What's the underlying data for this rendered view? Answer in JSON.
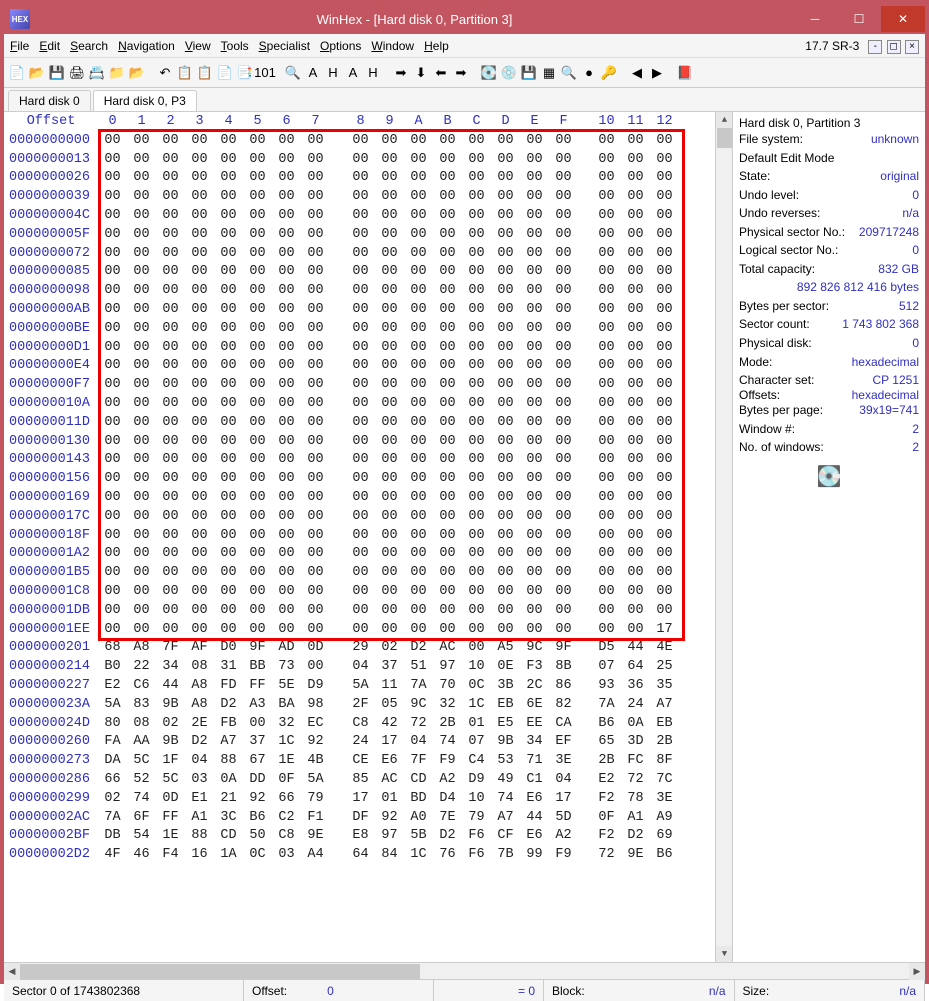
{
  "title": "WinHex - [Hard disk 0, Partition 3]",
  "version": "17.7 SR-3",
  "menus": [
    "File",
    "Edit",
    "Search",
    "Navigation",
    "View",
    "Tools",
    "Specialist",
    "Options",
    "Window",
    "Help"
  ],
  "tabs": [
    {
      "label": "Hard disk 0",
      "active": false
    },
    {
      "label": "Hard disk 0, P3",
      "active": true
    }
  ],
  "header_offset_label": "Offset",
  "cols": [
    "0",
    "1",
    "2",
    "3",
    "4",
    "5",
    "6",
    "7",
    "8",
    "9",
    "A",
    "B",
    "C",
    "D",
    "E",
    "F",
    "10",
    "11",
    "12"
  ],
  "zero_offsets": [
    "0000000000",
    "0000000013",
    "0000000026",
    "0000000039",
    "000000004C",
    "000000005F",
    "0000000072",
    "0000000085",
    "0000000098",
    "00000000AB",
    "00000000BE",
    "00000000D1",
    "00000000E4",
    "00000000F7",
    "000000010A",
    "000000011D",
    "0000000130",
    "0000000143",
    "0000000156",
    "0000000169",
    "000000017C",
    "000000018F",
    "00000001A2",
    "00000001B5",
    "00000001C8",
    "00000001DB",
    "00000001EE"
  ],
  "last_zero_tail": "17",
  "data_rows": [
    {
      "off": "0000000201",
      "b": [
        "68",
        "A8",
        "7F",
        "AF",
        "D0",
        "9F",
        "AD",
        "0D",
        "29",
        "02",
        "D2",
        "AC",
        "00",
        "A5",
        "9C",
        "9F",
        "D5",
        "44",
        "4E"
      ]
    },
    {
      "off": "0000000214",
      "b": [
        "B0",
        "22",
        "34",
        "08",
        "31",
        "BB",
        "73",
        "04",
        "37",
        "51",
        "97",
        "10",
        "0E",
        "F3",
        "8B",
        "07",
        "64",
        "25"
      ]
    },
    {
      "off": "0000000227",
      "b": [
        "E2",
        "C6",
        "44",
        "A8",
        "FD",
        "FF",
        "5E",
        "D9",
        "5A",
        "11",
        "7A",
        "70",
        "0C",
        "3B",
        "2C",
        "86",
        "93",
        "36",
        "35"
      ]
    },
    {
      "off": "000000023A",
      "b": [
        "5A",
        "83",
        "9B",
        "A8",
        "D2",
        "A3",
        "BA",
        "98",
        "2F",
        "05",
        "9C",
        "32",
        "1C",
        "EB",
        "6E",
        "82",
        "7A",
        "24",
        "A7"
      ]
    },
    {
      "off": "000000024D",
      "b": [
        "80",
        "08",
        "02",
        "2E",
        "FB",
        "00",
        "32",
        "EC",
        "C8",
        "42",
        "72",
        "2B",
        "01",
        "E5",
        "EE",
        "CA",
        "B6",
        "0A",
        "EB"
      ]
    },
    {
      "off": "0000000260",
      "b": [
        "FA",
        "AA",
        "9B",
        "D2",
        "A7",
        "37",
        "1C",
        "92",
        "24",
        "17",
        "04",
        "74",
        "07",
        "9B",
        "34",
        "EF",
        "65",
        "3D",
        "2B"
      ]
    },
    {
      "off": "0000000273",
      "b": [
        "DA",
        "5C",
        "1F",
        "04",
        "88",
        "67",
        "1E",
        "4B",
        "CE",
        "E6",
        "7F",
        "F9",
        "C4",
        "53",
        "71",
        "3E",
        "2B",
        "FC",
        "8F"
      ]
    },
    {
      "off": "0000000286",
      "b": [
        "66",
        "52",
        "5C",
        "03",
        "0A",
        "DD",
        "0F",
        "5A",
        "85",
        "AC",
        "CD",
        "A2",
        "D9",
        "49",
        "C1",
        "04",
        "E2",
        "72",
        "7C"
      ]
    },
    {
      "off": "0000000299",
      "b": [
        "02",
        "74",
        "0D",
        "E1",
        "21",
        "92",
        "66",
        "79",
        "17",
        "01",
        "BD",
        "D4",
        "10",
        "74",
        "E6",
        "17",
        "F2",
        "78",
        "3E"
      ]
    },
    {
      "off": "00000002AC",
      "b": [
        "7A",
        "6F",
        "FF",
        "A1",
        "3C",
        "B6",
        "C2",
        "F1",
        "DF",
        "92",
        "A0",
        "7E",
        "79",
        "A7",
        "44",
        "5D",
        "0F",
        "A1",
        "A9"
      ]
    },
    {
      "off": "00000002BF",
      "b": [
        "DB",
        "54",
        "1E",
        "88",
        "CD",
        "50",
        "C8",
        "9E",
        "E8",
        "97",
        "5B",
        "D2",
        "F6",
        "CF",
        "E6",
        "A2",
        "F2",
        "D2",
        "69"
      ]
    },
    {
      "off": "00000002D2",
      "b": [
        "4F",
        "46",
        "F4",
        "16",
        "1A",
        "0C",
        "03",
        "A4",
        "64",
        "84",
        "1C",
        "76",
        "F6",
        "7B",
        "99",
        "F9",
        "72",
        "9E",
        "B6"
      ]
    }
  ],
  "info": {
    "title": "Hard disk 0, Partition 3",
    "fs_label": "File system:",
    "fs_value": "unknown",
    "mode_title": "Default Edit Mode",
    "state_label": "State:",
    "state_value": "original",
    "undo_label": "Undo level:",
    "undo_value": "0",
    "undorev_label": "Undo reverses:",
    "undorev_value": "n/a",
    "phys_label": "Physical sector No.:",
    "phys_value": "209717248",
    "log_label": "Logical sector No.:",
    "log_value": "0",
    "cap_label": "Total capacity:",
    "cap_value": "832 GB",
    "cap_bytes": "892 826 812 416 bytes",
    "bps_label": "Bytes per sector:",
    "bps_value": "512",
    "sc_label": "Sector count:",
    "sc_value": "1 743 802 368",
    "pd_label": "Physical disk:",
    "pd_value": "0",
    "mode_label": "Mode:",
    "mode_value": "hexadecimal",
    "cs_label": "Character set:",
    "cs_value": "CP 1251",
    "off_label": "Offsets:",
    "off_value": "hexadecimal",
    "bpp_label": "Bytes per page:",
    "bpp_value": "39x19=741",
    "win_label": "Window #:",
    "win_value": "2",
    "nwin_label": "No. of windows:",
    "nwin_value": "2"
  },
  "status": {
    "sector": "Sector 0 of 1743802368",
    "offset_label": "Offset:",
    "offset_value": "0",
    "eq": "= 0",
    "block_label": "Block:",
    "block_value": "n/a",
    "size_label": "Size:",
    "size_value": "n/a"
  },
  "toolbar_icons": [
    "📄",
    "📂",
    "💾",
    "🖨",
    "📇",
    "📁",
    "📂",
    "",
    "↶",
    "📋",
    "📋",
    "📄",
    "📑",
    "101",
    "",
    "🔍",
    "A",
    "H",
    "A",
    "H",
    "",
    "➡",
    "⬇",
    "⬅",
    "➡",
    "",
    "💽",
    "💿",
    "💾",
    "▦",
    "🔍",
    "●",
    "🔑",
    "",
    "◀",
    "▶",
    "",
    "📕"
  ]
}
